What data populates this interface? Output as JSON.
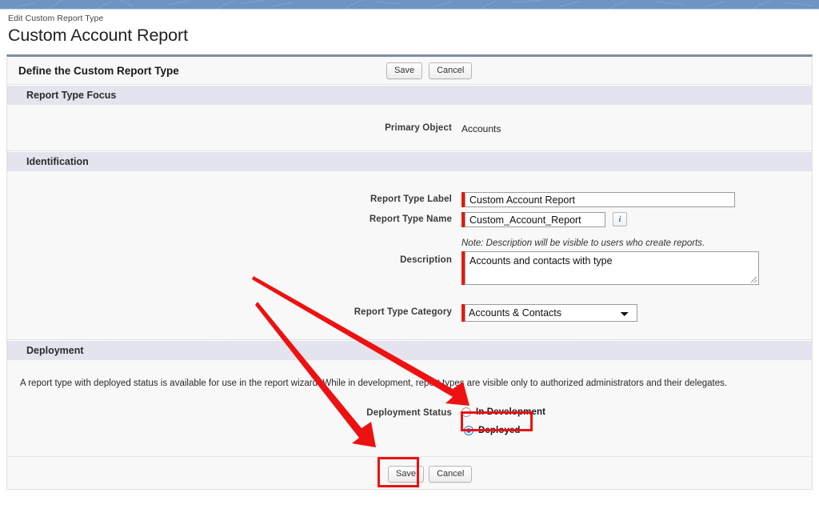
{
  "page": {
    "eyebrow": "Edit Custom Report Type",
    "title": "Custom Account Report"
  },
  "panel": {
    "title": "Define the Custom Report Type",
    "save_label": "Save",
    "cancel_label": "Cancel"
  },
  "sections": {
    "focus": {
      "heading": "Report Type Focus",
      "primary_object_label": "Primary Object",
      "primary_object_value": "Accounts"
    },
    "identification": {
      "heading": "Identification",
      "report_type_label_label": "Report Type Label",
      "report_type_label_value": "Custom Account Report",
      "report_type_name_label": "Report Type Name",
      "report_type_name_value": "Custom_Account_Report",
      "info_icon_glyph": "i",
      "description_note": "Note: Description will be visible to users who create reports.",
      "description_label": "Description",
      "description_value": "Accounts and contacts with type",
      "category_label": "Report Type Category",
      "category_value": "Accounts & Contacts",
      "category_options": [
        "Accounts & Contacts"
      ]
    },
    "deployment": {
      "heading": "Deployment",
      "description": "A report type with deployed status is available for use in the report wizard. While in development, report types are visible only to authorized administrators and their delegates.",
      "status_label": "Deployment Status",
      "options": [
        {
          "label": "In Development",
          "selected": false
        },
        {
          "label": "Deployed",
          "selected": true
        }
      ]
    }
  },
  "footer": {
    "save_label": "Save",
    "cancel_label": "Cancel"
  },
  "annotations": {
    "highlight_color": "#ee1111",
    "arrow_color": "#ee1111",
    "items": [
      {
        "name": "deployed-radio-highlight"
      },
      {
        "name": "footer-save-highlight"
      },
      {
        "name": "arrow-to-deployment-status"
      },
      {
        "name": "arrow-to-save-button"
      }
    ]
  },
  "theme": {
    "banner_blue": "#6e95c2",
    "section_header_bg": "#e3e4ee",
    "required_bar": "#e31b0c",
    "radio_selected": "#1878d4"
  }
}
